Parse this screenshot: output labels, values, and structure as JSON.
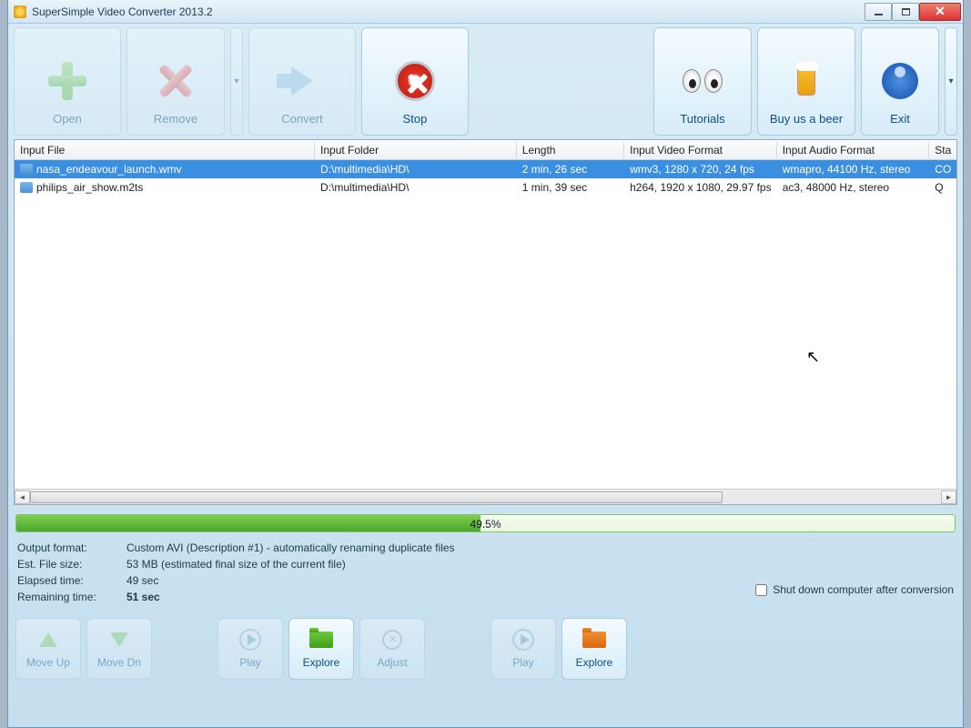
{
  "window": {
    "title": "SuperSimple Video Converter 2013.2"
  },
  "toolbar": {
    "open": "Open",
    "remove": "Remove",
    "convert": "Convert",
    "stop": "Stop",
    "tutorials": "Tutorials",
    "beer": "Buy us a beer",
    "exit": "Exit"
  },
  "columns": {
    "file": "Input File",
    "folder": "Input Folder",
    "length": "Length",
    "vformat": "Input Video Format",
    "aformat": "Input Audio Format",
    "status": "Sta"
  },
  "rows": [
    {
      "file": "nasa_endeavour_launch.wmv",
      "folder": "D:\\multimedia\\HD\\",
      "length": "2 min, 26 sec",
      "vf": "wmv3,  1280 x 720,  24 fps",
      "af": "wmapro,  44100 Hz, stereo",
      "st": "CO",
      "sel": true
    },
    {
      "file": "philips_air_show.m2ts",
      "folder": "D:\\multimedia\\HD\\",
      "length": "1 min, 39 sec",
      "vf": "h264,  1920 x 1080,  29.97 fps",
      "af": "ac3,  48000 Hz, stereo",
      "st": "Q",
      "sel": false
    }
  ],
  "progress": {
    "pct_text": "49.5%",
    "pct": 49.5
  },
  "info": {
    "output_label": "Output format:",
    "output_value": "Custom  AVI   (Description #1)  -  automatically renaming duplicate files",
    "size_label": "Est. File size:",
    "size_value": "53 MB     (estimated final size of the current file)",
    "elapsed_label": "Elapsed time:",
    "elapsed_value": "49 sec",
    "remaining_label": "Remaining time:",
    "remaining_value": "51 sec",
    "shutdown": "Shut down computer after conversion"
  },
  "bottom": {
    "moveup": "Move Up",
    "movedn": "Move Dn",
    "play": "Play",
    "explore": "Explore",
    "adjust": "Adjust"
  }
}
